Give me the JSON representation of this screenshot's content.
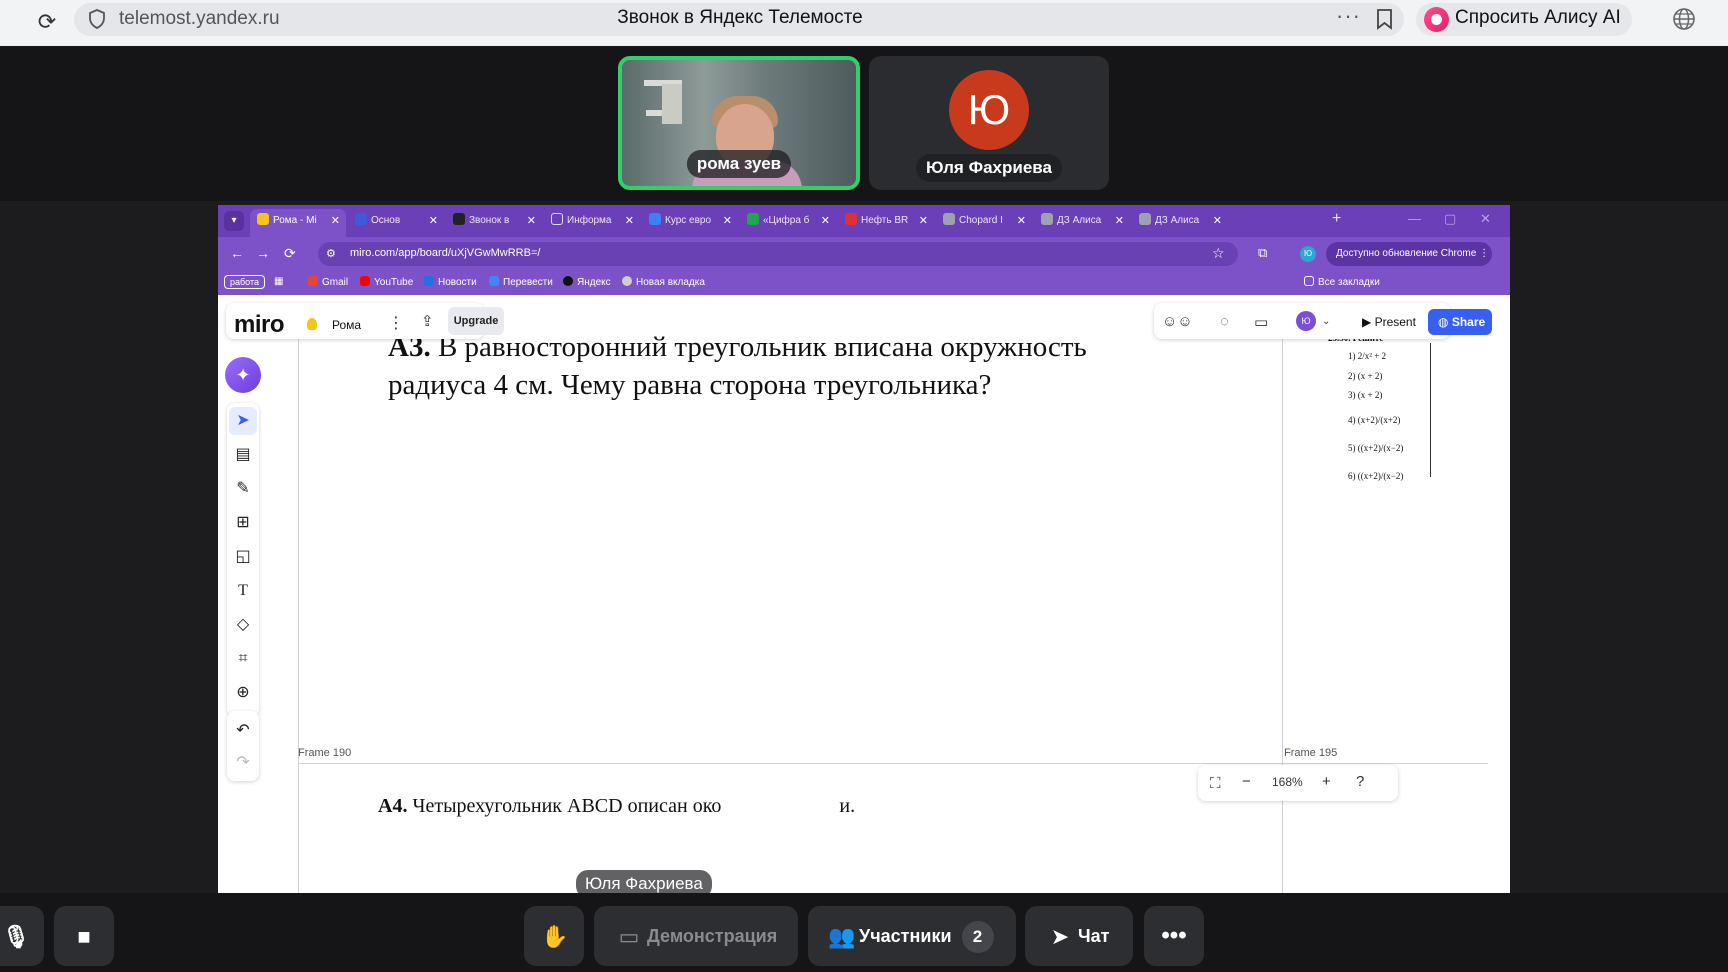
{
  "browser": {
    "url": "telemost.yandex.ru",
    "title": "Звонок в Яндекс Телемосте",
    "alice_button": "Спросить Алису AI",
    "menu_dots": "···"
  },
  "participants": [
    {
      "name": "рома зуев"
    },
    {
      "name": "Юля Фахриева",
      "avatar_initial": "Ю"
    }
  ],
  "shared_screen": {
    "chrome_tabs": [
      {
        "label": "Рома - Mi",
        "active": true,
        "favicon_color": "#f5c518"
      },
      {
        "label": "Основ",
        "favicon_color": "#3b5bdb"
      },
      {
        "label": "Звонок в",
        "favicon_color": "#222222"
      },
      {
        "label": "Информа",
        "favicon_color": "#6b3fb8"
      },
      {
        "label": "Курс евро",
        "favicon_color": "#3b82f6"
      },
      {
        "label": "«Цифра б",
        "favicon_color": "#1ea84a"
      },
      {
        "label": "Нефть BR",
        "favicon_color": "#e03131"
      },
      {
        "label": "Chopard I",
        "favicon_color": "#9ca3af"
      },
      {
        "label": "ДЗ Алиса",
        "favicon_color": "#9ca3af"
      },
      {
        "label": "ДЗ Алиса",
        "favicon_color": "#9ca3af"
      }
    ],
    "address": "miro.com/app/board/uXjVGwMwRRB=/",
    "update_label": "Доступно обновление Chrome",
    "profile_initial": "Ю",
    "bookmarks": {
      "group": "работа",
      "items": [
        {
          "label": "Gmail",
          "color": "#ea4335"
        },
        {
          "label": "YouTube",
          "color": "#ff0000"
        },
        {
          "label": "Новости",
          "color": "#1a73e8"
        },
        {
          "label": "Перевести",
          "color": "#4285f4"
        },
        {
          "label": "Яндекс",
          "color": "#111111"
        },
        {
          "label": "Новая вкладка",
          "color": "#cfcfcf"
        }
      ],
      "all": "Все закладки"
    },
    "miro": {
      "logo": "miro",
      "board_name": "Рома",
      "upgrade": "Upgrade",
      "present": "Present",
      "share": "Share",
      "user_initial": "Ю",
      "frame_left": "Frame 190",
      "frame_right": "Frame 195",
      "zoom": "168%",
      "task_a3_label": "А3.",
      "task_a3_line1": "В равносторонний треугольник вписана окружность",
      "task_a3_line2": "радиуса 4 см. Чему равна сторона треугольника?",
      "task_a4_label": "А4.",
      "task_a4_text": "Четырехугольник ABCD описан око",
      "task_a4_tail": "и.",
      "side_title": "23.30. Решите",
      "side_items": [
        "1) 2/x² + 2",
        "2) (x + 2)",
        "3) (x + 2)",
        "4) (x+2)/(x+2)",
        "5) ((x+2)/(x−2)",
        "6) ((x+2)/(x−2)"
      ]
    }
  },
  "active_speaker": "Юля Фахриева",
  "controls": {
    "demo": "Демонстрация",
    "participants": "Участники",
    "participants_count": "2",
    "chat": "Чат"
  },
  "colors": {
    "active_border": "#2ed16b",
    "miro_share": "#3760f0",
    "chrome_theme": "#7d52c9",
    "avatar": "#c9391b"
  }
}
